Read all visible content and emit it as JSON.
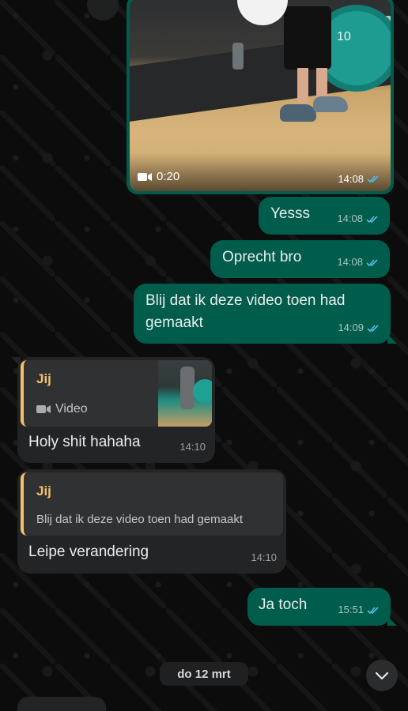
{
  "messages": {
    "video": {
      "duration": "0:20",
      "time": "14:08",
      "plate_label": "10"
    },
    "yesss": {
      "text": "Yesss",
      "time": "14:08"
    },
    "oprecht": {
      "text": "Oprecht bro",
      "time": "14:08"
    },
    "blij": {
      "text_line1": "Blij dat ik deze video toen had",
      "text_line2": "gemaakt",
      "time": "14:09"
    },
    "holy": {
      "quote_author": "Jij",
      "quote_type": "Video",
      "text": "Holy shit hahaha",
      "time": "14:10"
    },
    "leipe": {
      "quote_author": "Jij",
      "quote_text": "Blij dat ik deze video toen had gemaakt",
      "text": "Leipe verandering",
      "time": "14:10"
    },
    "ja_toch": {
      "text": "Ja toch",
      "time": "15:51"
    }
  },
  "date_separator": "do 12 mrt",
  "colors": {
    "outgoing_bubble": "#005c4b",
    "incoming_bubble": "#222425",
    "read_ticks": "#53bdeb",
    "quote_accent": "#f4c06b"
  },
  "icons": {
    "read": "double-check-icon",
    "video": "video-camera-icon",
    "scroll": "chevron-down-icon"
  }
}
